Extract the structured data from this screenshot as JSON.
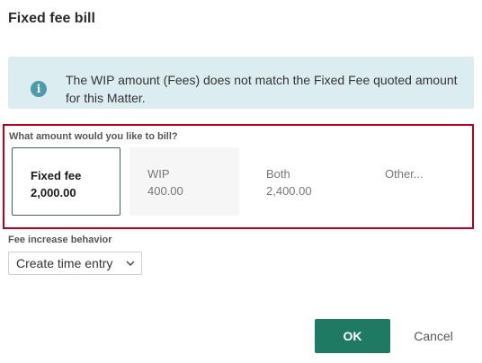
{
  "dialog": {
    "title": "Fixed fee bill"
  },
  "info_banner": {
    "icon": "info-icon",
    "icon_glyph": "i",
    "message": "The WIP amount (Fees) does not match the Fixed Fee quoted amount for this Matter."
  },
  "amount": {
    "question": "What amount would you like to bill?",
    "options": [
      {
        "label": "Fixed fee",
        "value": "2,000.00",
        "selected": true
      },
      {
        "label": "WIP",
        "value": "400.00",
        "selected": false
      },
      {
        "label": "Both",
        "value": "2,400.00",
        "selected": false
      },
      {
        "label": "Other...",
        "value": "",
        "selected": false
      }
    ],
    "highlight_color": "#b8001e"
  },
  "fee_increase": {
    "label": "Fee increase behavior",
    "selected_value": "Create time entry"
  },
  "actions": {
    "ok_label": "OK",
    "cancel_label": "Cancel",
    "ok_color": "#1f7a63"
  }
}
